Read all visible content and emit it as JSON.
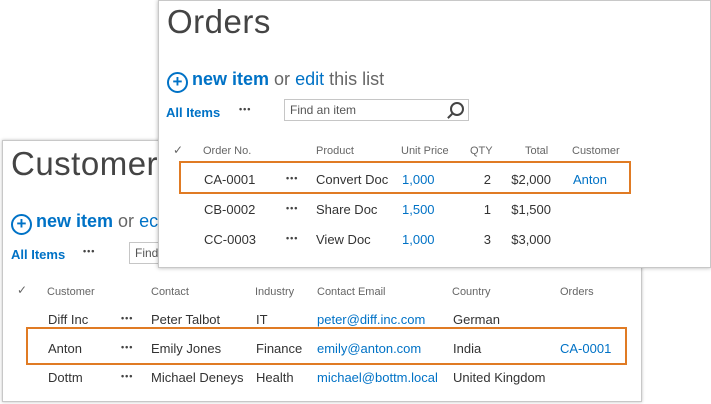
{
  "customers": {
    "title": "Customer",
    "new_item": "new item",
    "or": "or",
    "edit": "ec",
    "plus": "+",
    "all_items": "All Items",
    "dots": "•••",
    "search_placeholder": "Find",
    "check": "✓",
    "columns": [
      "Customer",
      "Contact",
      "Industry",
      "Contact Email",
      "Country",
      "Orders"
    ],
    "rows": [
      {
        "customer": "Diff Inc",
        "contact": "Peter Talbot",
        "industry": "IT",
        "email": "peter@diff.inc.com",
        "country": "German",
        "orders": ""
      },
      {
        "customer": "Anton",
        "contact": "Emily Jones",
        "industry": "Finance",
        "email": "emily@anton.com",
        "country": "India",
        "orders": "CA-0001"
      },
      {
        "customer": "Dottm",
        "contact": "Michael Deneys",
        "industry": "Health",
        "email": "michael@bottm.local",
        "country": "United Kingdom",
        "orders": ""
      }
    ]
  },
  "orders": {
    "title": "Orders",
    "new_item": "new item",
    "or": "or",
    "edit": "edit",
    "this_list": "this list",
    "plus": "+",
    "all_items": "All Items",
    "dots": "•••",
    "search_placeholder": "Find an item",
    "check": "✓",
    "columns": [
      "Order No.",
      "Product",
      "Unit Price",
      "QTY",
      "Total",
      "Customer"
    ],
    "rows": [
      {
        "order": "CA-0001",
        "product": "Convert Doc",
        "price": "1,000",
        "qty": "2",
        "total": "$2,000",
        "customer": "Anton"
      },
      {
        "order": "CB-0002",
        "product": "Share Doc",
        "price": "1,500",
        "qty": "1",
        "total": "$1,500",
        "customer": ""
      },
      {
        "order": "CC-0003",
        "product": "View Doc",
        "price": "1,000",
        "qty": "3",
        "total": "$3,000",
        "customer": ""
      }
    ]
  },
  "colors": {
    "accent": "#0072c6",
    "highlight": "#e07b24"
  }
}
